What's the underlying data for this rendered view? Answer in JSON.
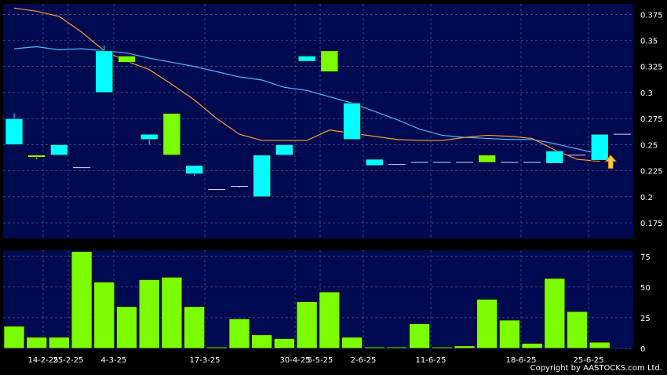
{
  "footer": {
    "copyright": "Copyright by AASTOCKS.com Ltd."
  },
  "colors": {
    "background": "#000000",
    "plot_bg": "#000a50",
    "up_candle": "#00ffff",
    "down_candle": "#7cfc00",
    "volume_bar": "#7cfc00",
    "ma_short": "#4fb5ff",
    "ma_long": "#ff9a2e",
    "marker_arrow": "#ffc53d",
    "grid": "#5a6aa8"
  },
  "chart_data": [
    {
      "type": "candlestick",
      "title": "",
      "ylim": [
        0.16,
        0.385
      ],
      "yticks": [
        "0.175",
        "0.2",
        "0.225",
        "0.25",
        "0.275",
        "0.3",
        "0.325",
        "0.35",
        "0.375"
      ],
      "grid": true,
      "x_tick_labels": [
        "14-2-25",
        "25-2-25",
        "4-3-25",
        "17-3-25",
        "30-4-25",
        "5-5-25",
        "2-6-25",
        "11-6-25",
        "18-6-25",
        "25-6-25"
      ],
      "candles": [
        {
          "open": 0.25,
          "close": 0.275,
          "high": 0.28,
          "low": 0.25
        },
        {
          "open": 0.24,
          "close": 0.238,
          "high": 0.24,
          "low": 0.236
        },
        {
          "open": 0.24,
          "close": 0.25,
          "high": 0.25,
          "low": 0.24
        },
        {
          "open": 0.228,
          "close": 0.228,
          "high": 0.228,
          "low": 0.228
        },
        {
          "open": 0.3,
          "close": 0.34,
          "high": 0.345,
          "low": 0.3
        },
        {
          "open": 0.335,
          "close": 0.329,
          "high": 0.335,
          "low": 0.329
        },
        {
          "open": 0.255,
          "close": 0.26,
          "high": 0.26,
          "low": 0.25
        },
        {
          "open": 0.28,
          "close": 0.24,
          "high": 0.28,
          "low": 0.24
        },
        {
          "open": 0.222,
          "close": 0.23,
          "high": 0.23,
          "low": 0.22
        },
        {
          "open": 0.207,
          "close": 0.207,
          "high": 0.207,
          "low": 0.207
        },
        {
          "open": 0.21,
          "close": 0.21,
          "high": 0.21,
          "low": 0.209
        },
        {
          "open": 0.2,
          "close": 0.24,
          "high": 0.24,
          "low": 0.2
        },
        {
          "open": 0.24,
          "close": 0.25,
          "high": 0.25,
          "low": 0.24
        },
        {
          "open": 0.33,
          "close": 0.335,
          "high": 0.335,
          "low": 0.33
        },
        {
          "open": 0.34,
          "close": 0.32,
          "high": 0.34,
          "low": 0.32
        },
        {
          "open": 0.255,
          "close": 0.29,
          "high": 0.29,
          "low": 0.255
        },
        {
          "open": 0.23,
          "close": 0.236,
          "high": 0.236,
          "low": 0.23
        },
        {
          "open": 0.231,
          "close": 0.231,
          "high": 0.231,
          "low": 0.231
        },
        {
          "open": 0.233,
          "close": 0.233,
          "high": 0.233,
          "low": 0.233
        },
        {
          "open": 0.233,
          "close": 0.233,
          "high": 0.233,
          "low": 0.233
        },
        {
          "open": 0.233,
          "close": 0.233,
          "high": 0.233,
          "low": 0.233
        },
        {
          "open": 0.24,
          "close": 0.233,
          "high": 0.24,
          "low": 0.233
        },
        {
          "open": 0.233,
          "close": 0.233,
          "high": 0.233,
          "low": 0.233
        },
        {
          "open": 0.233,
          "close": 0.233,
          "high": 0.233,
          "low": 0.233
        },
        {
          "open": 0.232,
          "close": 0.244,
          "high": 0.244,
          "low": 0.232
        },
        {
          "open": 0.24,
          "close": 0.24,
          "high": 0.24,
          "low": 0.24
        },
        {
          "open": 0.235,
          "close": 0.26,
          "high": 0.26,
          "low": 0.235
        },
        {
          "open": 0.26,
          "close": 0.26,
          "high": 0.26,
          "low": 0.26
        }
      ],
      "moving_averages": [
        {
          "values": [
            0.342,
            0.344,
            0.341,
            0.342,
            0.34,
            0.338,
            0.333,
            0.329,
            0.325,
            0.32,
            0.315,
            0.312,
            0.305,
            0.302,
            0.296,
            0.29,
            0.282,
            0.274,
            0.265,
            0.259,
            0.257,
            0.256,
            0.255,
            0.255,
            0.251,
            0.246,
            0.241
          ]
        },
        {
          "values": [
            0.381,
            0.378,
            0.373,
            0.358,
            0.34,
            0.33,
            0.322,
            0.308,
            0.293,
            0.275,
            0.26,
            0.254,
            0.254,
            0.254,
            0.264,
            0.261,
            0.258,
            0.255,
            0.254,
            0.254,
            0.257,
            0.259,
            0.258,
            0.256,
            0.245,
            0.236,
            0.234
          ]
        }
      ],
      "marker": {
        "index": 26,
        "symbol": "up-arrow"
      }
    },
    {
      "type": "bar",
      "title": "",
      "ylim": [
        0,
        80
      ],
      "yticks": [
        "0",
        "25",
        "50",
        "75"
      ],
      "grid": true,
      "values": [
        18,
        9,
        9,
        79,
        54,
        34,
        56,
        58,
        34,
        1,
        24,
        11,
        8,
        38,
        46,
        9,
        1,
        1,
        20,
        1,
        2,
        40,
        23,
        4,
        57,
        30,
        5
      ]
    }
  ]
}
